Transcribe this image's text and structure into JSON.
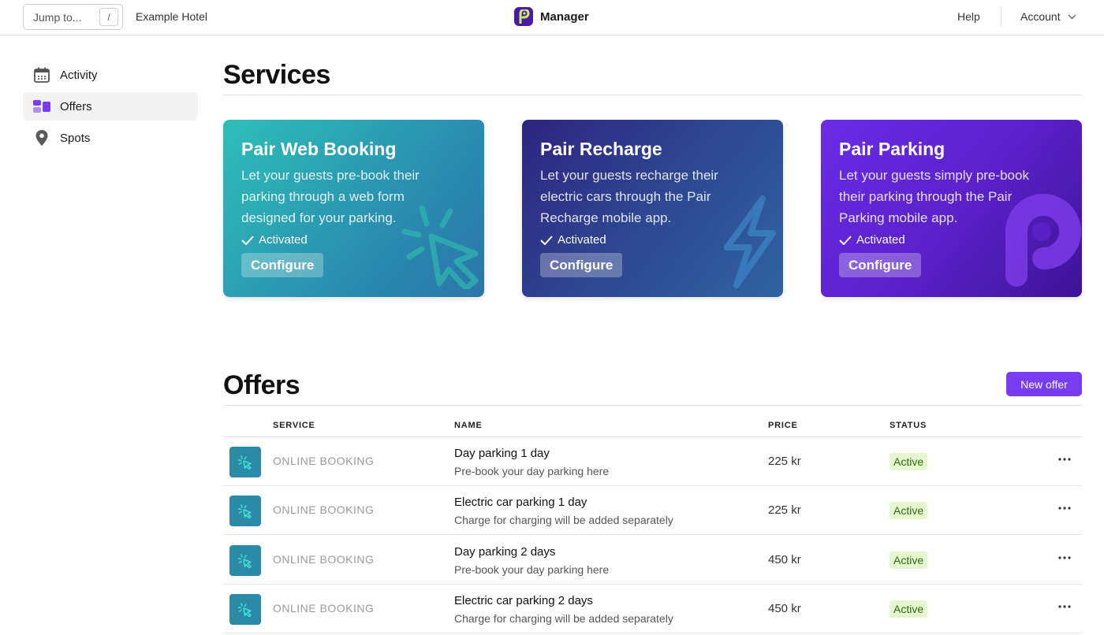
{
  "topbar": {
    "jump_placeholder": "Jump to...",
    "jump_shortcut": "/",
    "hotel": "Example Hotel",
    "app_name": "Manager",
    "help": "Help",
    "account": "Account"
  },
  "sidebar": {
    "items": [
      {
        "label": "Activity",
        "icon": "calendar-icon",
        "active": false
      },
      {
        "label": "Offers",
        "icon": "offers-icon",
        "active": true
      },
      {
        "label": "Spots",
        "icon": "location-pin-icon",
        "active": false
      }
    ]
  },
  "services": {
    "title": "Services",
    "cards": [
      {
        "title": "Pair Web Booking",
        "desc": "Let your guests pre-book their parking through a web form designed for your parking.",
        "status": "Activated",
        "button": "Configure",
        "icon": "cursor-click-icon"
      },
      {
        "title": "Pair Recharge",
        "desc": "Let your guests recharge their electric cars through the Pair Recharge mobile app.",
        "status": "Activated",
        "button": "Configure",
        "icon": "lightning-icon"
      },
      {
        "title": "Pair Parking",
        "desc": "Let your guests simply pre-book their parking through the Pair Parking mobile app.",
        "status": "Activated",
        "button": "Configure",
        "icon": "pair-p-logo-icon"
      }
    ]
  },
  "offers": {
    "title": "Offers",
    "new_button": "New offer",
    "columns": [
      "SERVICE",
      "NAME",
      "PRICE",
      "STATUS"
    ],
    "rows": [
      {
        "service": "ONLINE BOOKING",
        "name": "Day parking 1 day",
        "subtitle": "Pre-book your day parking here",
        "price": "225 kr",
        "status": "Active"
      },
      {
        "service": "ONLINE BOOKING",
        "name": "Electric car parking 1 day",
        "subtitle": "Charge for charging will be added separately",
        "price": "225 kr",
        "status": "Active"
      },
      {
        "service": "ONLINE BOOKING",
        "name": "Day parking 2 days",
        "subtitle": "Pre-book your day parking here",
        "price": "450 kr",
        "status": "Active"
      },
      {
        "service": "ONLINE BOOKING",
        "name": "Electric car parking 2 days",
        "subtitle": "Charge for charging will be added separately",
        "price": "450 kr",
        "status": "Active"
      }
    ]
  },
  "colors": {
    "accent": "#7a3cf0",
    "status_bg": "#e6f7cf",
    "status_text": "#2e6a10",
    "service_icon_bg": "#2b8aa8"
  }
}
